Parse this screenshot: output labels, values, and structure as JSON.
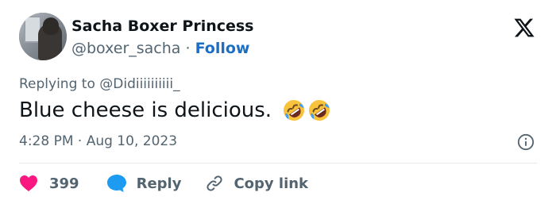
{
  "author": {
    "name": "Sacha Boxer Princess",
    "handle": "@boxer_sacha",
    "separator": "·",
    "follow_label": "Follow"
  },
  "tweet": {
    "replying_prefix": "Replying to",
    "replying_to": "@Didiiiiiiiiii_",
    "text": "Blue cheese is delicious.",
    "emojis": [
      "rolling-on-floor-laughing",
      "rolling-on-floor-laughing"
    ],
    "timestamp": "4:28 PM · Aug 10, 2023"
  },
  "actions": {
    "like_count": "399",
    "reply_label": "Reply",
    "copy_label": "Copy link"
  },
  "colors": {
    "follow": "#1d6fc4",
    "heart": "#f91880",
    "reply_bubble": "#1d9bf0",
    "muted": "#536471",
    "emoji_face": "#f9c23c"
  },
  "icons": {
    "logo": "x-logo-icon",
    "info": "info-icon",
    "like": "heart-icon",
    "reply": "speech-bubble-icon",
    "copy": "link-icon"
  }
}
